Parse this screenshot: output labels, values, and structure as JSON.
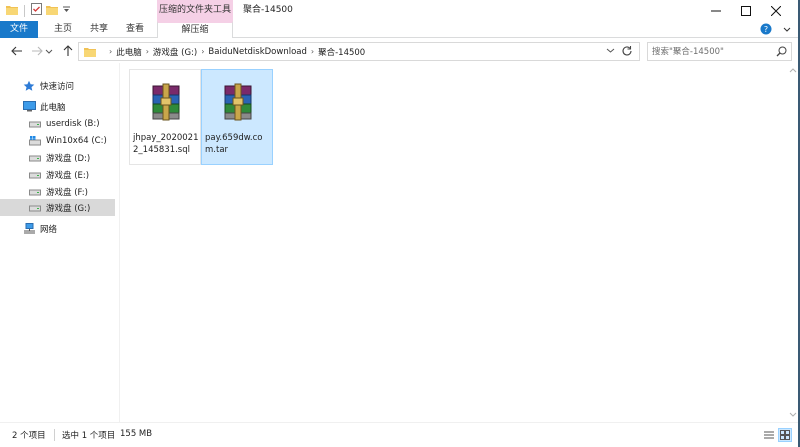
{
  "window": {
    "title": "聚合-14500",
    "context_tab_group": "压缩的文件夹工具",
    "controls": [
      "minimize",
      "maximize",
      "close"
    ]
  },
  "ribbon": {
    "tabs": [
      {
        "label": "文件",
        "active": true
      },
      {
        "label": "主页"
      },
      {
        "label": "共享"
      },
      {
        "label": "查看"
      },
      {
        "label": "解压缩",
        "contextual": true
      }
    ]
  },
  "nav": {
    "breadcrumbs": [
      "此电脑",
      "游戏盘 (G:)",
      "BaiduNetdiskDownload",
      "聚合-14500"
    ],
    "search_placeholder": "搜索\"聚合-14500\""
  },
  "navpane": {
    "items": [
      {
        "label": "快速访问",
        "icon": "star-icon",
        "indent": 0
      },
      {
        "label": "此电脑",
        "icon": "computer-icon",
        "indent": 0
      },
      {
        "label": "userdisk (B:)",
        "icon": "drive-icon",
        "indent": 1
      },
      {
        "label": "Win10x64 (C:)",
        "icon": "windows-drive-icon",
        "indent": 1
      },
      {
        "label": "游戏盘 (D:)",
        "icon": "drive-icon",
        "indent": 1
      },
      {
        "label": "游戏盘 (E:)",
        "icon": "drive-icon",
        "indent": 1
      },
      {
        "label": "游戏盘 (F:)",
        "icon": "drive-icon",
        "indent": 1
      },
      {
        "label": "游戏盘 (G:)",
        "icon": "drive-icon",
        "indent": 1,
        "selected": true
      },
      {
        "label": "网络",
        "icon": "network-icon",
        "indent": 0
      }
    ]
  },
  "files": [
    {
      "name": "jhpay_20200212_145831.sql",
      "icon": "winrar-archive-icon",
      "selected": false
    },
    {
      "name": "pay.659dw.com.tar",
      "icon": "winrar-archive-icon",
      "selected": true
    }
  ],
  "status": {
    "item_count": "2 个项目",
    "selected_count": "选中 1 个项目",
    "selected_size": "155 MB"
  },
  "colors": {
    "accent": "#1979ca",
    "context_tab": "#f5d0e6",
    "selection_bg": "#cce8ff",
    "selection_border": "#99d1ff"
  }
}
